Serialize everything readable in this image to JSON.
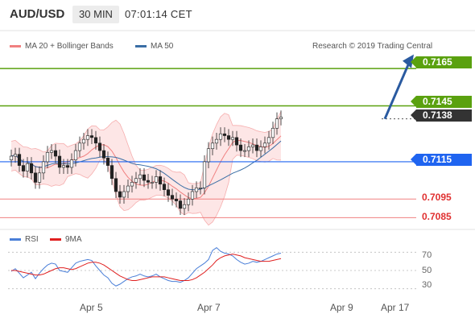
{
  "header": {
    "pair": "AUD/USD",
    "timeframe": "30 MIN",
    "time": "07:01:14 CET"
  },
  "legend": {
    "bollinger": "MA 20 + Bollinger Bands",
    "ma50": "MA 50",
    "copyright": "Research © 2019 Trading Central"
  },
  "rsi_legend": {
    "rsi": "RSI",
    "ma": "9MA"
  },
  "colors": {
    "price_up": "#5aa10f",
    "support": "#1f64f0",
    "bollinger": "#f08080",
    "ma50": "#3a6ea5",
    "rsi": "#4a7fd8",
    "rsi_ma": "#e02020",
    "current": "#333333"
  },
  "chart_data": [
    {
      "type": "line",
      "ylim": [
        0.708,
        0.7175
      ],
      "x_ticks": [
        "Apr 5",
        "Apr 7",
        "Apr 9",
        "Apr 17"
      ],
      "levels": {
        "resistance": [
          "0.7165",
          "0.7145"
        ],
        "current": "0.7138",
        "support": [
          "0.7115",
          "0.7095",
          "0.7085"
        ]
      },
      "x_candles": [
        0,
        5,
        10,
        15,
        20,
        25,
        30,
        35,
        40,
        45,
        50,
        55,
        60,
        65,
        70,
        75,
        80,
        85,
        90,
        95,
        100,
        105,
        110,
        115,
        120,
        125,
        130,
        135,
        140,
        145,
        150,
        155,
        160,
        165,
        170,
        175,
        180,
        185,
        190,
        195,
        200,
        205,
        210,
        215,
        220,
        225,
        230,
        235,
        240,
        245,
        250,
        255,
        260,
        265,
        270,
        275,
        280,
        285,
        290,
        295,
        300,
        305,
        310,
        315,
        320,
        325,
        330,
        335,
        340,
        345,
        350,
        355,
        360,
        365,
        370,
        375,
        380,
        385,
        390,
        395,
        400,
        405,
        410,
        415,
        420,
        425,
        430,
        435,
        440,
        445,
        450,
        455,
        460
      ],
      "close": [
        0.7118,
        0.7119,
        0.7113,
        0.711,
        0.7114,
        0.7109,
        0.7104,
        0.7109,
        0.7115,
        0.712,
        0.7121,
        0.7118,
        0.7112,
        0.7113,
        0.7112,
        0.7116,
        0.7121,
        0.7125,
        0.7127,
        0.7129,
        0.7128,
        0.7125,
        0.7121,
        0.7117,
        0.7113,
        0.7106,
        0.7099,
        0.7096,
        0.7099,
        0.7102,
        0.7104,
        0.7106,
        0.7108,
        0.7105,
        0.7104,
        0.7104,
        0.7107,
        0.7103,
        0.71,
        0.7097,
        0.7095,
        0.7094,
        0.709,
        0.7092,
        0.7095,
        0.7099,
        0.7101,
        0.7101,
        0.7115,
        0.7122,
        0.7125,
        0.7127,
        0.713,
        0.7129,
        0.7127,
        0.7128,
        0.7124,
        0.7121,
        0.7121,
        0.7123,
        0.7124,
        0.7121,
        0.7123,
        0.7125,
        0.7128,
        0.7133,
        0.7138,
        0.7139
      ],
      "forecast_target": 0.717,
      "series": [
        {
          "name": "MA 20 + Bollinger Bands"
        },
        {
          "name": "MA 50"
        }
      ]
    },
    {
      "type": "line",
      "ylim": [
        20,
        80
      ],
      "y_ticks": [
        "70",
        "50",
        "30"
      ],
      "series": [
        {
          "name": "RSI",
          "values": [
            49,
            52,
            47,
            42,
            45,
            48,
            41,
            47,
            52,
            56,
            58,
            57,
            50,
            49,
            48,
            53,
            58,
            60,
            61,
            62,
            61,
            55,
            50,
            45,
            42,
            36,
            33,
            35,
            38,
            41,
            43,
            44,
            46,
            44,
            43,
            44,
            46,
            43,
            41,
            39,
            38,
            38,
            37,
            39,
            42,
            47,
            52,
            55,
            58,
            62,
            72,
            75,
            71,
            69,
            68,
            66,
            62,
            59,
            57,
            58,
            60,
            59,
            60,
            62,
            64,
            66,
            68,
            69
          ]
        },
        {
          "name": "9MA",
          "values": [
            50,
            50,
            49,
            48,
            47,
            46,
            45,
            45,
            46,
            48,
            50,
            52,
            53,
            53,
            52,
            51,
            52,
            54,
            56,
            58,
            59,
            59,
            58,
            56,
            53,
            50,
            47,
            44,
            42,
            40,
            39,
            39,
            40,
            41,
            42,
            43,
            43,
            43,
            43,
            42,
            41,
            40,
            39,
            39,
            39,
            40,
            42,
            45,
            48,
            52,
            56,
            61,
            64,
            66,
            67,
            68,
            67,
            66,
            64,
            63,
            62,
            61,
            60,
            60,
            60,
            61,
            62,
            63
          ]
        }
      ]
    }
  ]
}
